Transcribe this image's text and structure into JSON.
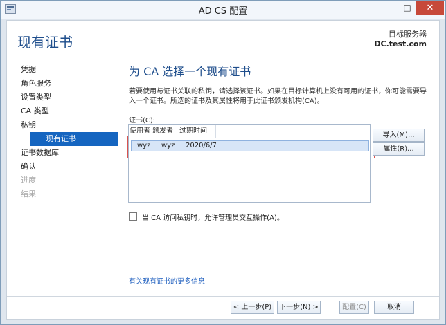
{
  "window": {
    "title": "AD CS 配置",
    "controls": {
      "minimize": "—",
      "maximize": "□",
      "close": "✕"
    }
  },
  "header": {
    "page_title": "现有证书",
    "server_label": "目标服务器",
    "server_name": "DC.test.com"
  },
  "nav": {
    "items": [
      {
        "label": "凭据",
        "state": "normal"
      },
      {
        "label": "角色服务",
        "state": "normal"
      },
      {
        "label": "设置类型",
        "state": "normal"
      },
      {
        "label": "CA 类型",
        "state": "normal"
      },
      {
        "label": "私钥",
        "state": "normal"
      },
      {
        "label": "现有证书",
        "state": "active"
      },
      {
        "label": "证书数据库",
        "state": "normal"
      },
      {
        "label": "确认",
        "state": "normal"
      },
      {
        "label": "进度",
        "state": "disabled"
      },
      {
        "label": "结果",
        "state": "disabled"
      }
    ]
  },
  "main": {
    "section_title": "为 CA 选择一个现有证书",
    "description": "若要使用与证书关联的私钥，请选择该证书。如果在目标计算机上没有可用的证书，你可能需要导入一个证书。所选的证书及其属性将用于此证书颁发机构(CA)。",
    "list_label": "证书(C):",
    "columns": [
      "使用者",
      "颁发者",
      "过期时间"
    ],
    "rows": [
      {
        "subject": "wyz",
        "issuer": "wyz",
        "expires": "2020/6/7"
      }
    ],
    "import_button": "导入(M)...",
    "properties_button": "属性(R)...",
    "checkbox_label": "当 CA 访问私钥时，允许管理员交互操作(A)。",
    "checkbox_checked": false,
    "more_link": "有关现有证书的更多信息"
  },
  "footer": {
    "back": "< 上一步(P)",
    "next": "下一步(N) >",
    "configure": "配置(C)",
    "cancel": "取消"
  },
  "colors": {
    "accent": "#1565c0",
    "title": "#1f4e8c",
    "annotation": "#d9534f"
  }
}
